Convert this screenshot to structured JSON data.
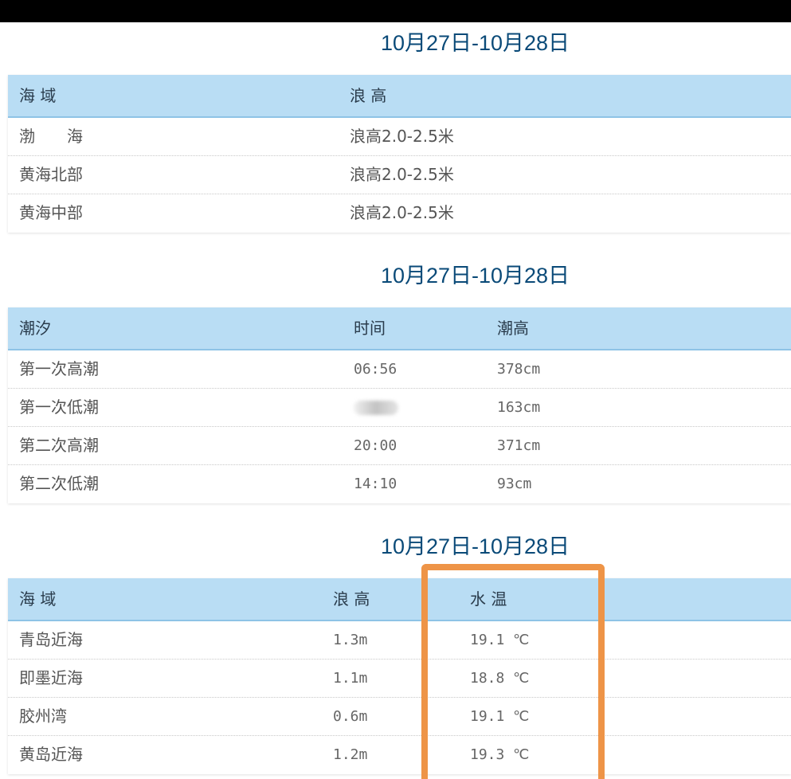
{
  "colors": {
    "title": "#0a4a78",
    "header_bg": "#b9ddf4",
    "highlight": "#ee9447"
  },
  "sections": [
    {
      "title": "10月27日-10月28日",
      "headers": [
        "海 域",
        "浪 高"
      ],
      "rows": [
        [
          "渤　　海",
          "浪高2.0-2.5米"
        ],
        [
          "黄海北部",
          "浪高2.0-2.5米"
        ],
        [
          "黄海中部",
          "浪高2.0-2.5米"
        ]
      ]
    },
    {
      "title": "10月27日-10月28日",
      "headers": [
        "潮汐",
        "时间",
        "潮高"
      ],
      "rows": [
        [
          "第一次高潮",
          "06:56",
          "378cm"
        ],
        [
          "第一次低潮",
          "",
          "163cm"
        ],
        [
          "第二次高潮",
          "20:00",
          "371cm"
        ],
        [
          "第二次低潮",
          "14:10",
          "93cm"
        ]
      ]
    },
    {
      "title": "10月27日-10月28日",
      "headers": [
        "海 域",
        "浪 高",
        "水 温"
      ],
      "rows": [
        [
          "青岛近海",
          "1.3m",
          "19.1 ℃"
        ],
        [
          "即墨近海",
          "1.1m",
          "18.8 ℃"
        ],
        [
          "胶州湾",
          "0.6m",
          "19.1 ℃"
        ],
        [
          "黄岛近海",
          "1.2m",
          "19.3 ℃"
        ]
      ]
    }
  ]
}
